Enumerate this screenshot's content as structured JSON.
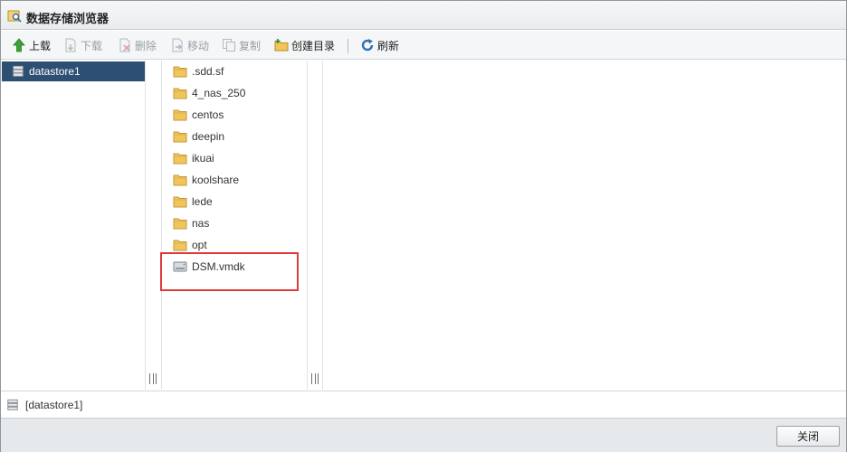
{
  "window": {
    "title": "数据存储浏览器",
    "icon": "datastore-browser-icon"
  },
  "toolbar": {
    "upload": "上载",
    "download": "下载",
    "delete": "删除",
    "move": "移动",
    "copy": "复制",
    "create_folder": "创建目录",
    "refresh": "刷新"
  },
  "datastores": [
    {
      "label": "datastore1",
      "selected": true
    }
  ],
  "files": [
    {
      "name": ".sdd.sf",
      "type": "folder"
    },
    {
      "name": "4_nas_250",
      "type": "folder"
    },
    {
      "name": "centos",
      "type": "folder"
    },
    {
      "name": "deepin",
      "type": "folder"
    },
    {
      "name": "ikuai",
      "type": "folder"
    },
    {
      "name": "koolshare",
      "type": "folder"
    },
    {
      "name": "lede",
      "type": "folder"
    },
    {
      "name": "nas",
      "type": "folder"
    },
    {
      "name": "opt",
      "type": "folder"
    },
    {
      "name": "DSM.vmdk",
      "type": "disk",
      "highlighted": true
    }
  ],
  "status": {
    "path": "[datastore1]"
  },
  "footer": {
    "close": "关闭"
  },
  "colors": {
    "selection": "#2d4f73",
    "highlight_box": "#e03a3a",
    "folder": "#f2c55c"
  }
}
